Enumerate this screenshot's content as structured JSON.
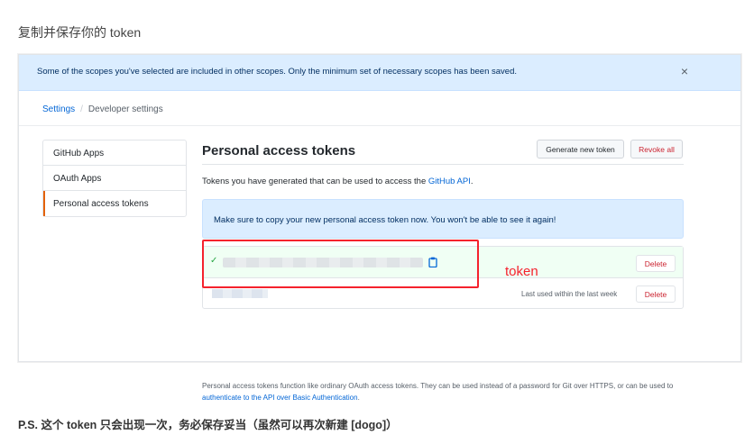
{
  "page": {
    "heading": "复制并保存你的 token",
    "ps_note": "P.S. 这个 token 只会出现一次，务必保存妥当（虽然可以再次新建 [dogo]）"
  },
  "flash": {
    "message": "Some of the scopes you've selected are included in other scopes. Only the minimum set of necessary scopes has been saved.",
    "close_glyph": "×"
  },
  "breadcrumb": {
    "root": "Settings",
    "separator": "/",
    "current": "Developer settings"
  },
  "sidebar": {
    "items": [
      {
        "label": "GitHub Apps"
      },
      {
        "label": "OAuth Apps"
      },
      {
        "label": "Personal access tokens"
      }
    ],
    "selected_accent": "#e36209"
  },
  "main": {
    "title": "Personal access tokens",
    "generate_label": "Generate new token",
    "revoke_label": "Revoke all",
    "description_prefix": "Tokens you have generated that can be used to access the ",
    "description_link": "GitHub API",
    "description_suffix": ".",
    "notice": "Make sure to copy your new personal access token now. You won't be able to see it again!"
  },
  "tokens": [
    {
      "value": "ghp_xxxxxxxxxxxxxxxxxxxxxxxxxxxxxxxxxxxx",
      "delete_label": "Delete",
      "check_glyph": "✓",
      "copy_icon": "clipboard-icon"
    },
    {
      "name": "token",
      "last_used": "Last used within the last week",
      "delete_label": "Delete"
    }
  ],
  "footnote": {
    "text": "Personal access tokens function like ordinary OAuth access tokens. They can be used instead of a password for Git over HTTPS, or can be used to ",
    "link": "authenticate to the API over Basic Authentication",
    "suffix": "."
  },
  "annotation": {
    "label": "token",
    "color": "#f5222d"
  }
}
